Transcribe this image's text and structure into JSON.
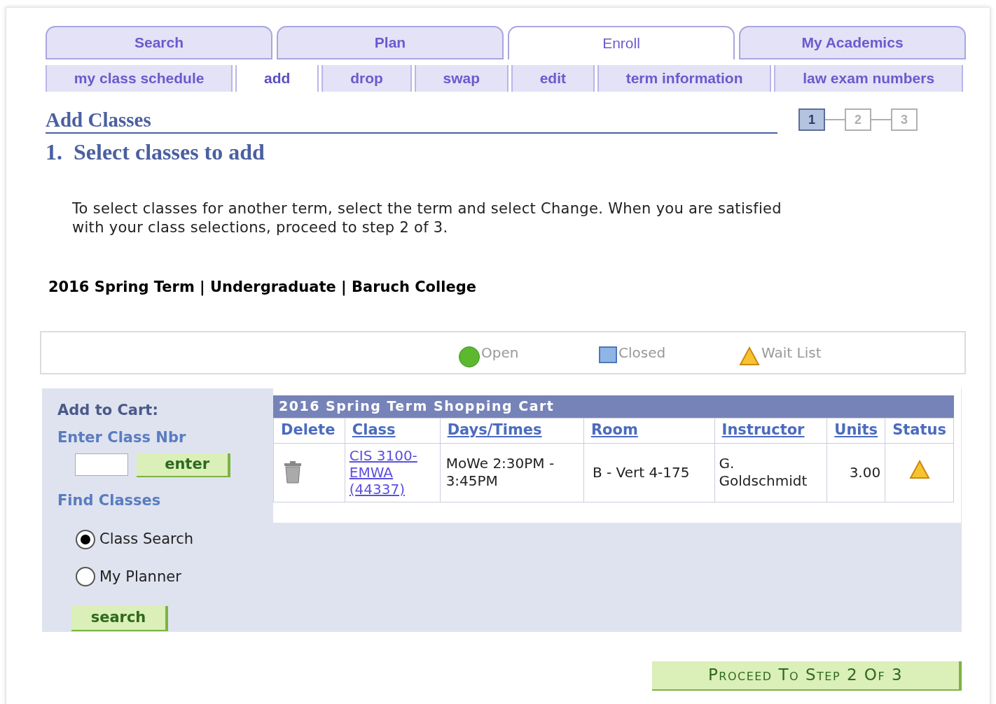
{
  "tabs": [
    {
      "label": "Search",
      "selected": false
    },
    {
      "label": "Plan",
      "selected": false
    },
    {
      "label": "Enroll",
      "selected": true
    },
    {
      "label": "My Academics",
      "selected": false
    }
  ],
  "subtabs": [
    {
      "label": "my class schedule",
      "selected": false
    },
    {
      "label": "add",
      "selected": true
    },
    {
      "label": "drop",
      "selected": false
    },
    {
      "label": "swap",
      "selected": false
    },
    {
      "label": "edit",
      "selected": false
    },
    {
      "label": "term information",
      "selected": false
    },
    {
      "label": "law exam numbers",
      "selected": false
    }
  ],
  "title": "Add Classes",
  "step_title": "1.  Select classes to add",
  "steps": [
    {
      "label": "1",
      "selected": true
    },
    {
      "label": "2",
      "selected": false
    },
    {
      "label": "3",
      "selected": false
    }
  ],
  "instructions": "To select classes for another term, select the term and select Change.  When you are satisfied with your class selections, proceed to step 2 of 3.",
  "term": "2016 Spring Term | Undergraduate | Baruch College",
  "legend": [
    {
      "kind": "open",
      "label": "Open"
    },
    {
      "kind": "closed",
      "label": "Closed"
    },
    {
      "kind": "waitlist",
      "label": "Wait List"
    }
  ],
  "add_to_cart": {
    "heading": "Add to Cart:",
    "class_nbr_label": "Enter Class Nbr",
    "enter_button": "enter",
    "find_heading": "Find Classes",
    "options": [
      {
        "label": "Class Search",
        "selected": true
      },
      {
        "label": "My Planner",
        "selected": false
      }
    ],
    "search_button": "search"
  },
  "cart": {
    "title": "2016 Spring Term Shopping Cart",
    "columns": [
      "Delete",
      "Class",
      "Days/Times",
      "Room",
      "Instructor",
      "Units",
      "Status"
    ],
    "rows": [
      {
        "class": "CIS 3100-EMWA (44337)",
        "days_times": "MoWe 2:30PM - 3:45PM",
        "room": "B - Vert 4-175",
        "instructor": "G. Goldschmidt",
        "units": "3.00",
        "kind": "waitlist"
      }
    ]
  },
  "proceed_button": "Proceed To Step 2 Of 3"
}
